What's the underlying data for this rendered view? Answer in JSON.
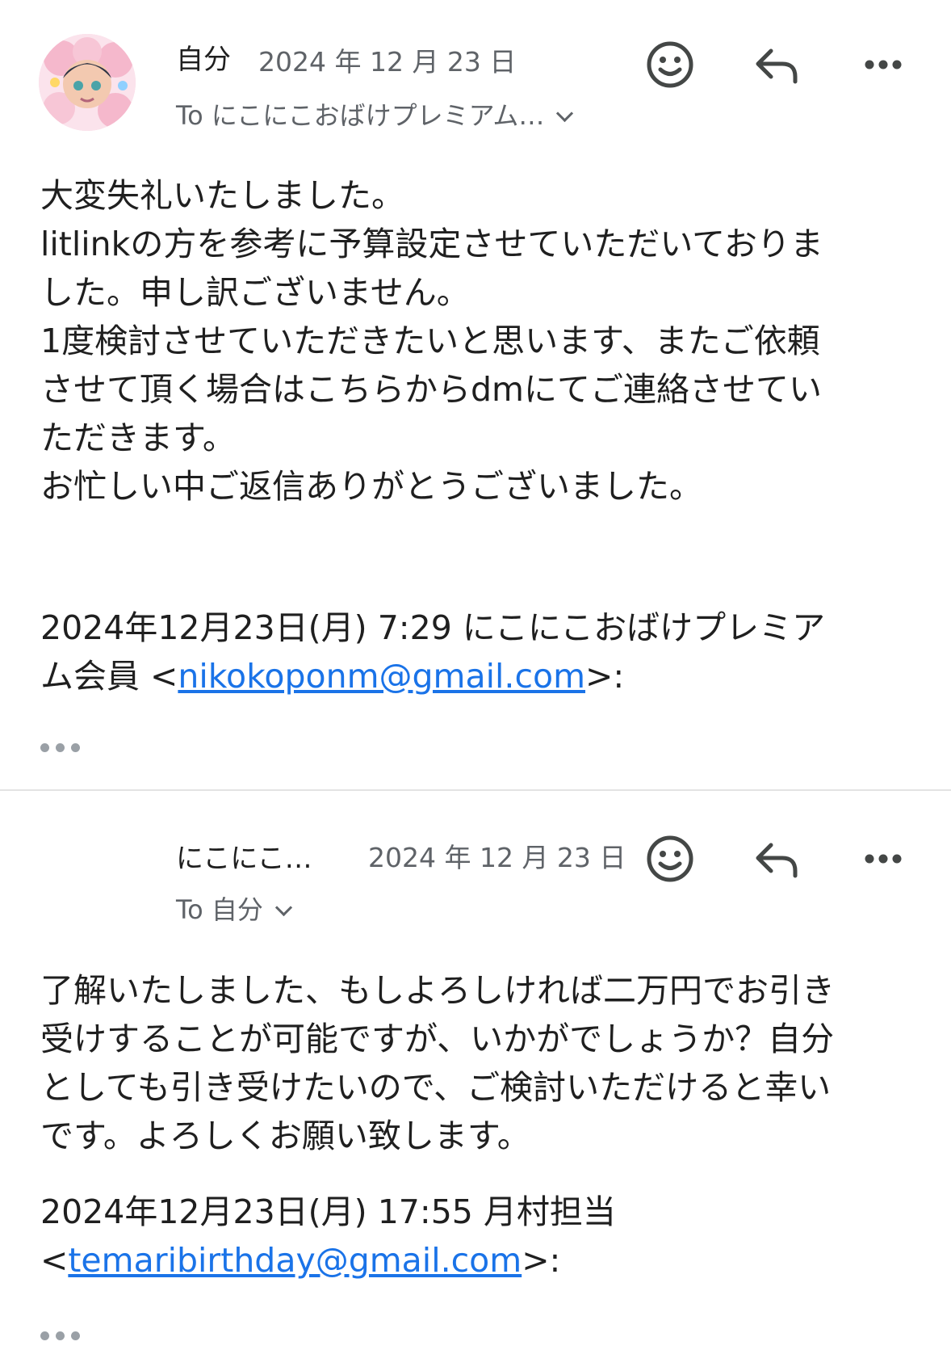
{
  "thread": [
    {
      "sender": "自分",
      "date": "2024 年 12 月 23 日",
      "recipient": "To にこにこおばけプレミアム…",
      "body": "大変失礼いたしました。\nlitlinkの方を参考に予算設定させていただいておりま\nした。申し訳ございません。\n1度検討させていただきたいと思います、またご依頼\nさせて頂く場合はこちらからdmにてご連絡させてい\nただきます。\nお忙しい中ご返信ありがとうございました。",
      "quote_prefix": "2024年12月23日(月) 7:29 にこにこおばけプレミア\nム会員 <",
      "quote_email": "nikokoponm@gmail.com",
      "quote_suffix": ">:"
    },
    {
      "sender": "にこにこ…",
      "date": "2024 年 12 月 23 日",
      "recipient": "To 自分",
      "body": "了解いたしました、もしよろしければ二万円でお引き\n受けすることが可能ですが、いかがでしょうか？自分\nとしても引き受けたいので、ご検討いただけると幸い\nです。よろしくお願い致します。",
      "quote_prefix": "2024年12月23日(月) 17:55 月村担当\n<",
      "quote_email": "temaribirthday@gmail.com",
      "quote_suffix": ">:"
    }
  ],
  "colors": {
    "link": "#1a73e8",
    "secondary_text": "#5f6368",
    "icon": "#444746",
    "divider": "#e3e3e3"
  }
}
